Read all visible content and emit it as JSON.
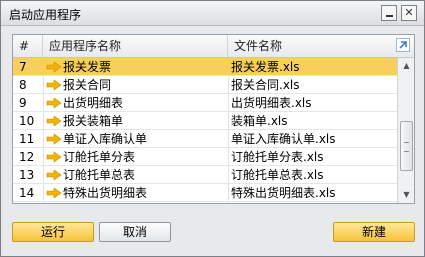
{
  "window": {
    "title": "启动应用程序",
    "minimize_label": "_",
    "close_label": "✕"
  },
  "table": {
    "headers": {
      "index": "#",
      "name": "应用程序名称",
      "file": "文件名称"
    },
    "rows": [
      {
        "index": "7",
        "name": "报关发票",
        "file": "报关发票.xls",
        "selected": true
      },
      {
        "index": "8",
        "name": "报关合同",
        "file": "报关合同.xls"
      },
      {
        "index": "9",
        "name": "出货明细表",
        "file": "出货明细表.xls"
      },
      {
        "index": "10",
        "name": "报关装箱单",
        "file": "装箱单.xls"
      },
      {
        "index": "11",
        "name": "单证入库确认单",
        "file": "单证入库确认单.xls"
      },
      {
        "index": "12",
        "name": "订舱托单分表",
        "file": "订舱托单分表.xls"
      },
      {
        "index": "13",
        "name": "订舱托单总表",
        "file": "订舱托单总表.xls"
      },
      {
        "index": "14",
        "name": "特殊出货明细表",
        "file": "特殊出货明细表.xls"
      }
    ]
  },
  "buttons": {
    "run": "运行",
    "cancel": "取消",
    "new": "新建"
  },
  "colors": {
    "selected_row": "#f7cf5a",
    "arrow": "#f2b400",
    "link_icon": "#3d7fd1"
  },
  "icons": {
    "row_marker": "right-arrow-icon",
    "header_link": "expand-link-icon"
  }
}
